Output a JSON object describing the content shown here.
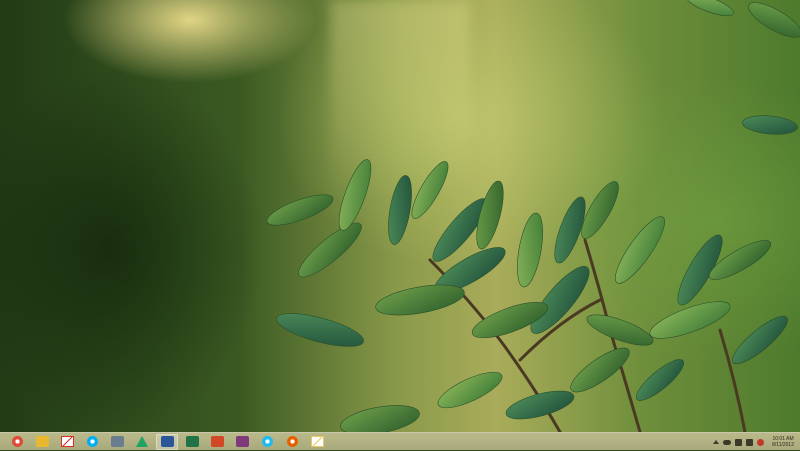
{
  "desktop": {
    "wallpaper": "green-leaves-photo"
  },
  "taskbar": {
    "apps": [
      {
        "icon": "chrome-icon",
        "color": "#dd4b39"
      },
      {
        "icon": "file-explorer-icon",
        "color": "#e8b830"
      },
      {
        "icon": "gmail-icon",
        "color": "#d93025"
      },
      {
        "icon": "skype-icon",
        "color": "#00aff0"
      },
      {
        "icon": "keyboard-icon",
        "color": "#6a7d8f"
      },
      {
        "icon": "google-drive-icon",
        "color": "#1fa463"
      },
      {
        "icon": "word-icon",
        "color": "#2b579a"
      },
      {
        "icon": "excel-icon",
        "color": "#217346"
      },
      {
        "icon": "powerpoint-icon",
        "color": "#d24726"
      },
      {
        "icon": "onenote-icon",
        "color": "#80397b"
      },
      {
        "icon": "internet-explorer-icon",
        "color": "#1ebbee"
      },
      {
        "icon": "firefox-icon",
        "color": "#e66000"
      },
      {
        "icon": "mail-icon",
        "color": "#e8c860"
      }
    ],
    "tray": {
      "icons": [
        "show-hidden-icons-chevron",
        "cloud-icon",
        "battery-icon",
        "network-icon",
        "volume-icon"
      ],
      "time": "10:01 AM",
      "date": "8/11/2012"
    }
  }
}
